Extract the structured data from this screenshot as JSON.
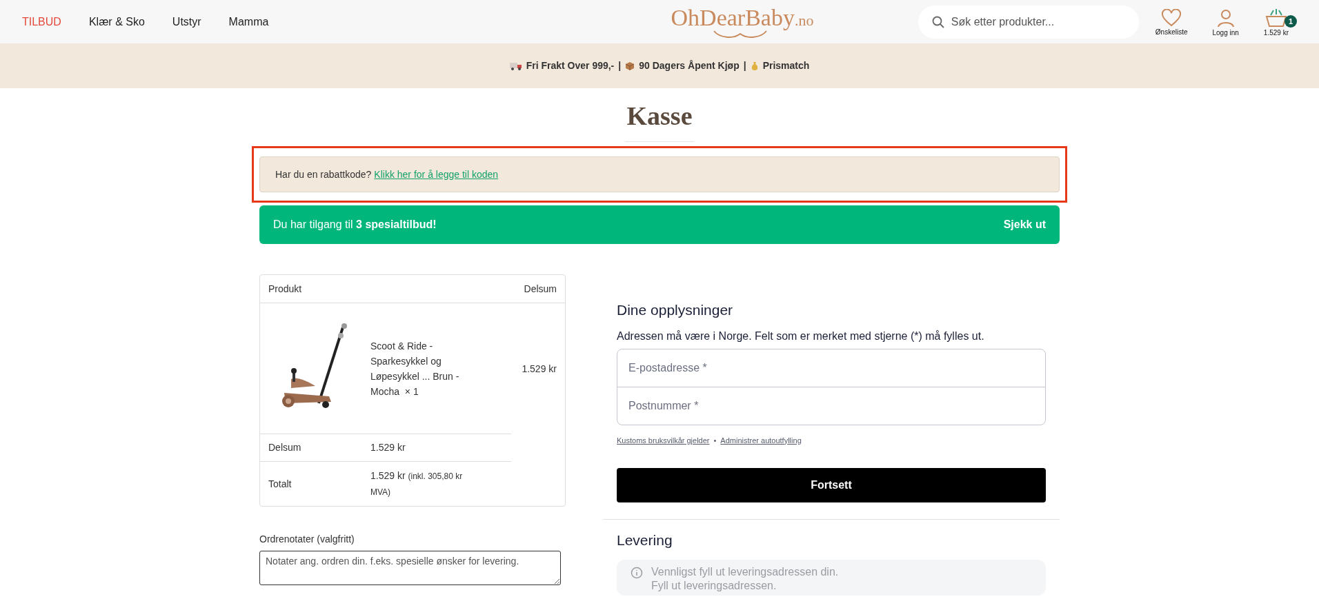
{
  "header": {
    "nav": [
      {
        "label": "TILBUD",
        "kind": "sale"
      },
      {
        "label": "Klær & Sko",
        "kind": "normal"
      },
      {
        "label": "Utstyr",
        "kind": "normal"
      },
      {
        "label": "Mamma",
        "kind": "normal"
      }
    ],
    "logo": {
      "name": "OhDearBaby",
      "suffix": ".no"
    },
    "search": {
      "placeholder": "Søk etter produkter..."
    },
    "actions": [
      {
        "label": "Ønskeliste",
        "kind": "heart"
      },
      {
        "label": "Logg inn",
        "kind": "user"
      },
      {
        "label": "1.529 kr",
        "kind": "cart",
        "badge": "1"
      }
    ]
  },
  "promo_bar": [
    {
      "text": "Fri Frakt Over 999,-",
      "kind": "truck"
    },
    {
      "text": "|",
      "kind": "separator"
    },
    {
      "text": "90 Dagers Åpent Kjøp",
      "kind": "box"
    },
    {
      "text": "|",
      "kind": "separator"
    },
    {
      "text": "Prismatch",
      "kind": "money"
    }
  ],
  "title": "Kasse",
  "coupon": {
    "text": "Har du en rabattkode?",
    "link": "Klikk her for å legge til koden",
    "highlighted": true
  },
  "offer": {
    "text": "Du har tilgang til **3 spesialtilbud!**",
    "action": "Sjekk ut"
  },
  "order_table": {
    "columns": [
      "Produkt",
      "Delsum"
    ],
    "item": {
      "name": "Scoot & Ride - Sparkesykkel og Løpesykkel ... Brun - Mocha",
      "qty": "× 1",
      "price": "1.529 kr"
    },
    "subtotal": {
      "label": "Delsum",
      "value": "1.529 kr"
    },
    "total": {
      "label": "Totalt",
      "value": "1.529 kr",
      "note": "(inkl. 305,80 kr MVA)"
    }
  },
  "order_notes": {
    "label": "Ordrenotater (valgfritt)",
    "placeholder": "Notater ang. ordren din. f.eks. spesielle ønsker for levering."
  },
  "details": {
    "heading": "Dine opplysninger",
    "intro": "Adressen må være i Norge. Felt som er merket med stjerne (*) må fylles ut.",
    "fields": [
      {
        "placeholder": "E-postadresse *"
      },
      {
        "placeholder": "Postnummer *"
      }
    ],
    "links": [
      "Kustoms bruksvilkår gjelder",
      "Administrer autoutfylling"
    ],
    "separator": "•",
    "button": "Fortsett"
  },
  "delivery": {
    "heading": "Levering",
    "info": [
      "Vennligst fyll ut leveringsadressen din.",
      "Fyll ut leveringsadressen."
    ]
  }
}
